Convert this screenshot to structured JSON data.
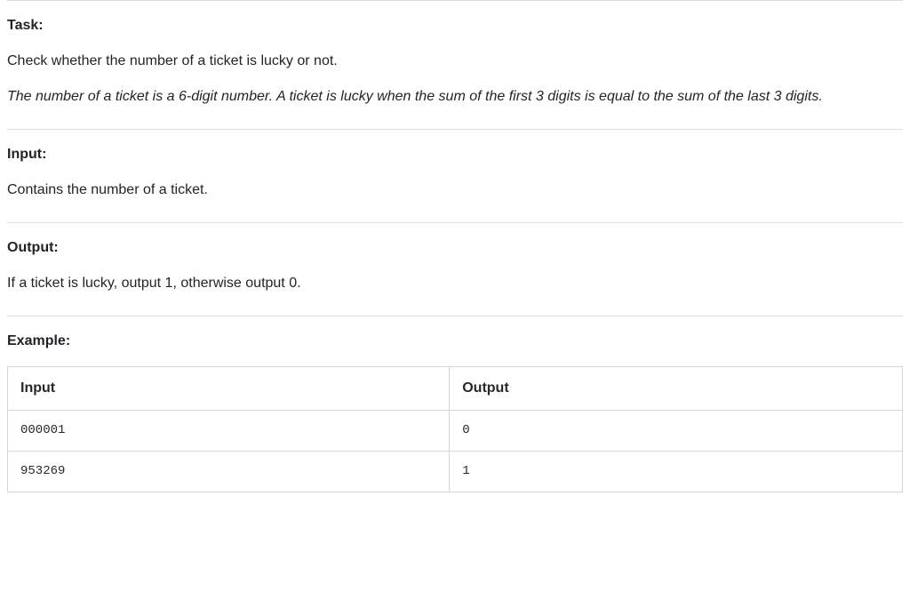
{
  "task": {
    "label": "Task:",
    "description": "Check whether the number of a ticket is lucky or not.",
    "note": "The number of a ticket is a 6-digit number. A ticket is lucky when the sum of the first 3 digits is equal to the sum of the last 3 digits."
  },
  "input": {
    "label": "Input:",
    "description": "Contains the number of a ticket."
  },
  "output": {
    "label": "Output:",
    "description": "If a ticket is lucky, output 1, otherwise output 0."
  },
  "example": {
    "label": "Example:",
    "headers": {
      "input": "Input",
      "output": "Output"
    },
    "rows": [
      {
        "input": "000001",
        "output": "0"
      },
      {
        "input": "953269",
        "output": "1"
      }
    ]
  }
}
